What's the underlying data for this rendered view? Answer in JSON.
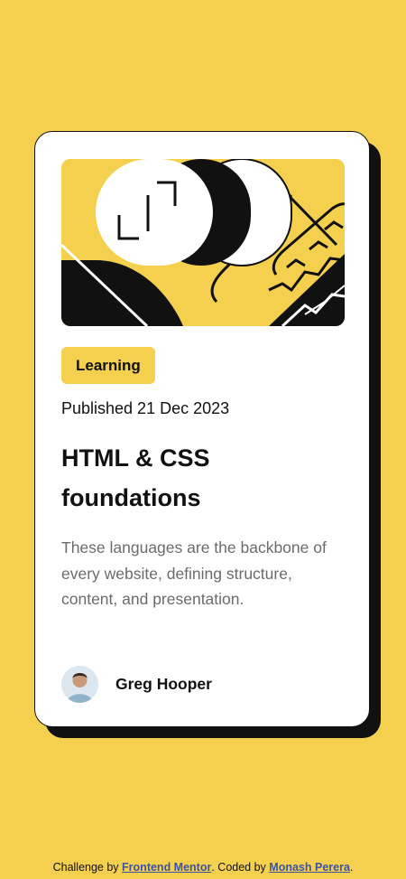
{
  "card": {
    "tag_label": "Learning",
    "published": "Published 21 Dec 2023",
    "title": "HTML & CSS foundations",
    "description": "These languages are the backbone of every website, defining structure, content, and presentation.",
    "author_name": "Greg Hooper"
  },
  "footer": {
    "prefix": "Challenge by ",
    "link1": "Frontend Mentor",
    "middle": ". Coded by ",
    "link2": "Monash Perera",
    "suffix": "."
  },
  "colors": {
    "background": "#F4D04E",
    "card": "#FFFFFF",
    "text": "#111111",
    "muted": "#6B6B6B",
    "link": "#3E52A3"
  },
  "icons": [
    "hero-illustration",
    "author-avatar"
  ]
}
